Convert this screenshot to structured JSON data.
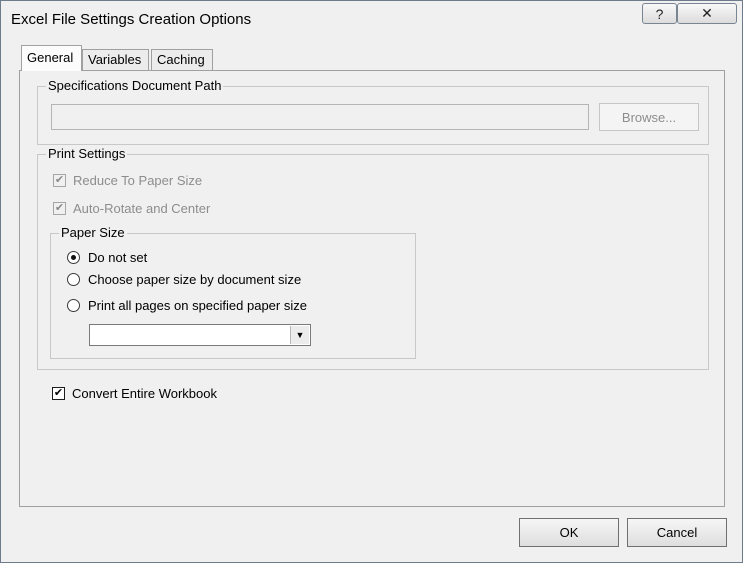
{
  "window": {
    "title": "Excel File Settings Creation Options"
  },
  "titlebar_buttons": {
    "help": "?",
    "close": "✕"
  },
  "tabs": [
    {
      "label": "General",
      "active": true
    },
    {
      "label": "Variables",
      "active": false
    },
    {
      "label": "Caching",
      "active": false
    }
  ],
  "spec_path": {
    "group_title": "Specifications Document Path",
    "value": "",
    "browse_label": "Browse..."
  },
  "print_settings": {
    "group_title": "Print Settings",
    "reduce_label": "Reduce To Paper Size",
    "reduce_checked": true,
    "autorotate_label": "Auto-Rotate and Center",
    "autorotate_checked": true
  },
  "paper_size": {
    "group_title": "Paper Size",
    "options": [
      {
        "label": "Do not set",
        "selected": true
      },
      {
        "label": "Choose paper size by document size",
        "selected": false
      },
      {
        "label": "Print all pages on specified paper size",
        "selected": false
      }
    ],
    "dropdown_value": ""
  },
  "convert": {
    "label": "Convert Entire Workbook",
    "checked": true
  },
  "buttons": {
    "ok": "OK",
    "cancel": "Cancel"
  }
}
